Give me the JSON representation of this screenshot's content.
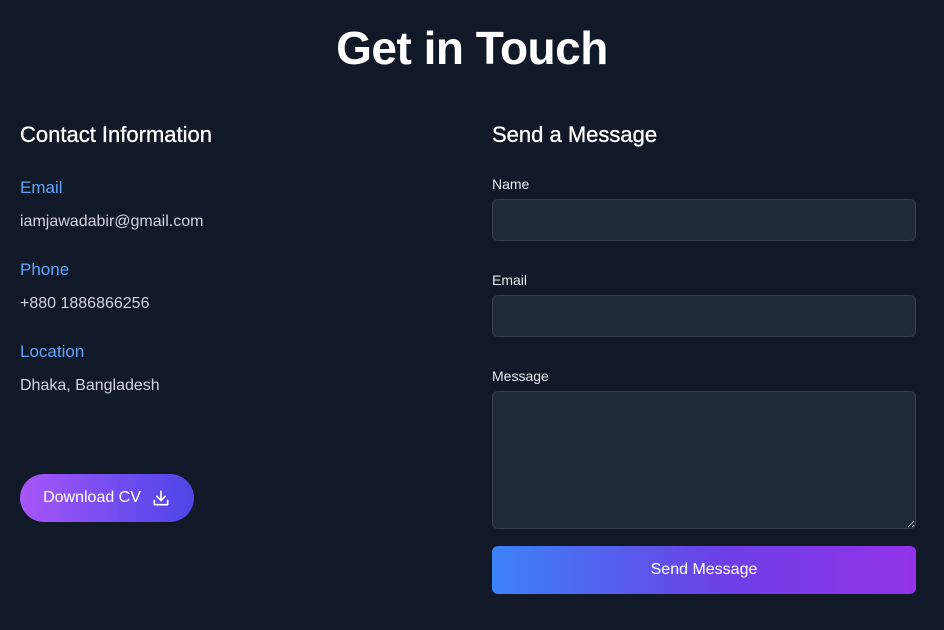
{
  "page": {
    "title": "Get in Touch"
  },
  "contact_info": {
    "heading": "Contact Information",
    "items": [
      {
        "label": "Email",
        "value": "iamjawadabir@gmail.com"
      },
      {
        "label": "Phone",
        "value": "+880 1886866256"
      },
      {
        "label": "Location",
        "value": "Dhaka, Bangladesh"
      }
    ],
    "download_button": {
      "label": "Download CV",
      "icon": "download-icon"
    }
  },
  "message_form": {
    "heading": "Send a Message",
    "name_field": {
      "label": "Name",
      "value": "",
      "placeholder": ""
    },
    "email_field": {
      "label": "Email",
      "value": "",
      "placeholder": ""
    },
    "message_field": {
      "label": "Message",
      "value": "",
      "placeholder": ""
    },
    "submit_label": "Send Message"
  },
  "colors": {
    "background": "#111827",
    "accent_label": "#60a5fa",
    "input_bg": "#1f2937",
    "cv_gradient_start": "#a855f7",
    "cv_gradient_end": "#4f46e5",
    "send_gradient_start": "#3b82f6",
    "send_gradient_end": "#9333ea"
  }
}
